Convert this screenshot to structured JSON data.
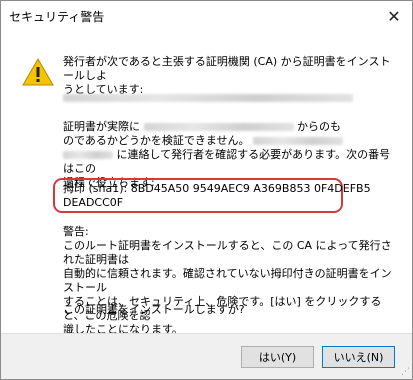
{
  "window": {
    "title": "セキュリティ警告",
    "close_glyph": "✕"
  },
  "icons": {
    "warning": "warning-icon",
    "close": "close-icon",
    "grip": "resize-grip-icon"
  },
  "message": {
    "intro_line1": "発行者が次であると主張する証明機関 (CA) から証明書をインストールしよ",
    "intro_line2": "うとしています:",
    "verify_line1_start": "証明書が実際に",
    "verify_line1_end": "からのも",
    "verify_line2": "のであるかどうかを検証できません。",
    "verify_line3_end": "に連絡して発行者を確認する必要があります。次の番号はこの",
    "verify_line4": "過程で役立ちます:",
    "thumbprint_line1": "拇印 (sha1): 8BD45A50 9549AEC9 A369B853 0F4DEFB5",
    "thumbprint_line2": "DEADCC0F",
    "warning_heading": "警告:",
    "warning_line1": "このルート証明書をインストールすると、この CA によって発行された証明書は",
    "warning_line2": "自動的に信頼されます。確認されていない拇印付きの証明書をインストール",
    "warning_line3": "することは、セキュリティ上、危険です。[はい] をクリックすると、この危険を認",
    "warning_line4": "識したことになります。",
    "question": "この証明書をインストールしますか?"
  },
  "buttons": {
    "yes": "はい(Y)",
    "no": "いいえ(N)"
  },
  "colors": {
    "highlight_border": "#d23b3b",
    "default_button_border": "#0078d7",
    "warning_yellow": "#f5c400"
  }
}
